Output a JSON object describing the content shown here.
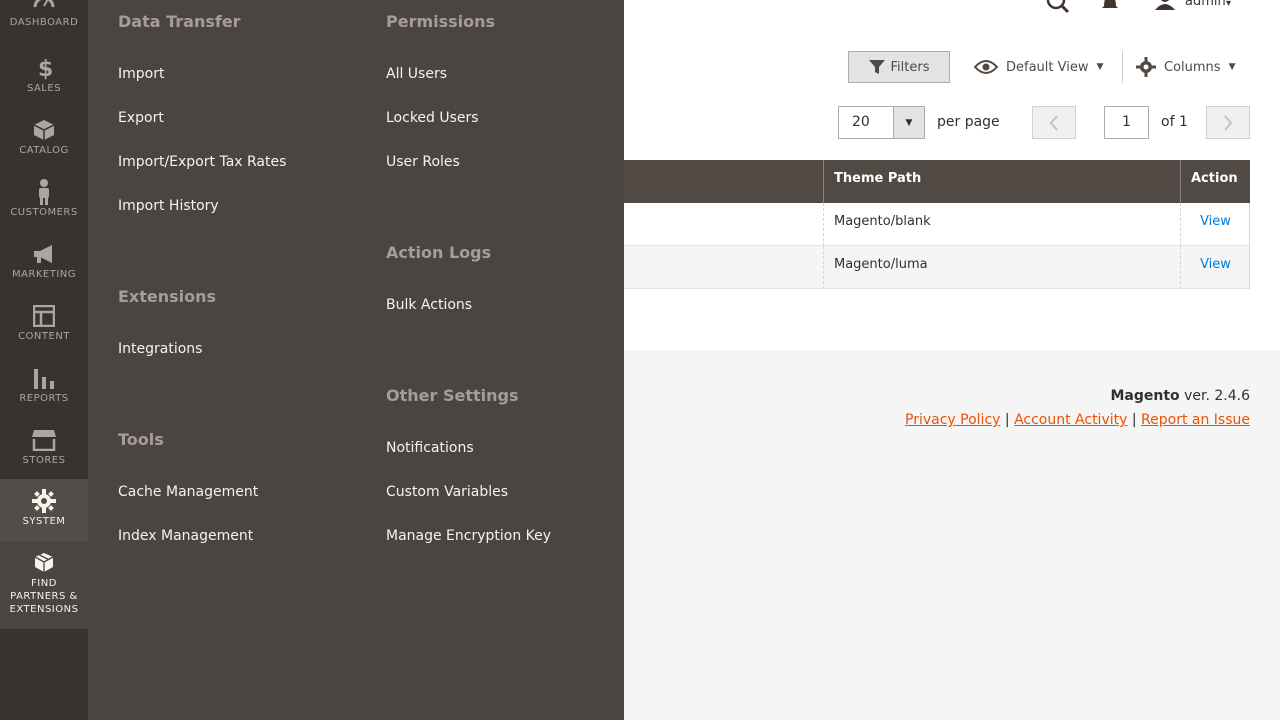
{
  "nav": {
    "items": [
      {
        "label": "Dashboard",
        "icon": "dashboard-icon"
      },
      {
        "label": "Sales",
        "icon": "dollar-icon"
      },
      {
        "label": "Catalog",
        "icon": "cube-icon"
      },
      {
        "label": "Customers",
        "icon": "person-icon"
      },
      {
        "label": "Marketing",
        "icon": "megaphone-icon"
      },
      {
        "label": "Content",
        "icon": "layout-icon"
      },
      {
        "label": "Reports",
        "icon": "bar-chart-icon"
      },
      {
        "label": "Stores",
        "icon": "store-icon"
      },
      {
        "label": "System",
        "icon": "gear-icon"
      }
    ],
    "partners_label_1": "Find",
    "partners_label_2": "Partners &",
    "partners_label_3": "Extensions"
  },
  "submenu": {
    "data_transfer": {
      "heading": "Data Transfer",
      "links": [
        "Import",
        "Export",
        "Import/Export Tax Rates",
        "Import History"
      ]
    },
    "extensions": {
      "heading": "Extensions",
      "links": [
        "Integrations"
      ]
    },
    "tools": {
      "heading": "Tools",
      "links": [
        "Cache Management",
        "Index Management"
      ]
    },
    "permissions": {
      "heading": "Permissions",
      "links": [
        "All Users",
        "Locked Users",
        "User Roles"
      ]
    },
    "action_logs": {
      "heading": "Action Logs",
      "links": [
        "Bulk Actions"
      ]
    },
    "other_settings": {
      "heading": "Other Settings",
      "links": [
        "Notifications",
        "Custom Variables",
        "Manage Encryption Key"
      ]
    }
  },
  "header": {
    "admin_name": "admin"
  },
  "toolbar": {
    "filters_label": "Filters",
    "view_label": "Default View",
    "columns_label": "Columns",
    "per_page_value": "20",
    "per_page_label": "per page",
    "page_value": "1",
    "page_of": "of 1"
  },
  "grid": {
    "columns": [
      "Theme Path",
      "Action"
    ],
    "rows": [
      {
        "path": "Magento/blank",
        "action": "View"
      },
      {
        "path": "Magento/luma",
        "action": "View"
      }
    ]
  },
  "footer": {
    "brand": "Magento",
    "version": " ver. 2.4.6",
    "privacy": "Privacy Policy",
    "sep1": " | ",
    "activity": " Account Activity",
    "sep2": " | ",
    "report": "Report an Issue"
  },
  "colors": {
    "nav_bg": "#373330",
    "submenu_bg": "#4a4542",
    "accent_link": "#eb5202",
    "grid_link": "#007bdb"
  }
}
